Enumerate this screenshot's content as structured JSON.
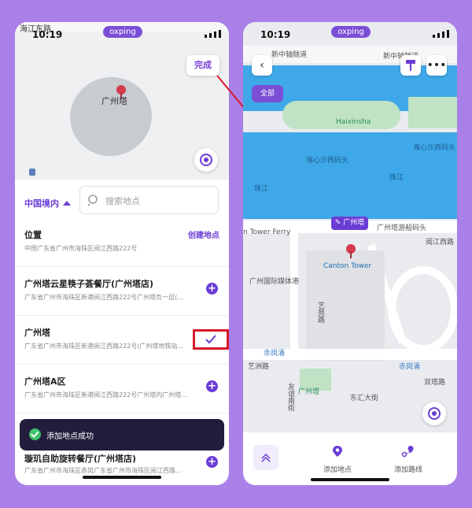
{
  "colors": {
    "accent": "#6b3cd5",
    "water": "#3ea8e8",
    "park": "#bfe3c4",
    "highlight": "#d61a2a"
  },
  "status_bar": {
    "time": "10:19",
    "pill": "oxping"
  },
  "left_phone": {
    "map": {
      "tower_label": "广州塔",
      "top_road": "海江东路",
      "done_label": "完成"
    },
    "sheet": {
      "region": "中国境内",
      "search_placeholder": "搜索地点",
      "location_title": "位置",
      "location_addr": "中国广东省广州市海珠区阅江西路222号",
      "create_label": "创建地点",
      "results": [
        {
          "title": "广州塔云星筷子荟餐厅(广州塔店)",
          "addr": "广东省广州市海珠区新港阅江西路222号广州塔负一层(...",
          "action": "add"
        },
        {
          "title": "广州塔",
          "addr": "广东省广州市海珠区新港阅江西路222号(广州塔地铁站...",
          "action": "added"
        },
        {
          "title": "广州塔A区",
          "addr": "广东省广州市海珠区新港阅江西路222号广州塔内广州塔...",
          "action": "add"
        },
        {
          "title": "璇玑自助旋转餐厅(广州塔店)",
          "addr": "广东省广州市海珠区赤岗广东省广州市海珠区阅江西路...",
          "action": "add"
        }
      ],
      "toast": "添加地点成功"
    }
  },
  "right_phone": {
    "top_labels": [
      "新中轴隧道",
      "新中轴隧道"
    ],
    "all_label": "全部",
    "tag_label": "广州塔",
    "map_labels": {
      "haixinsha": "Haixinsha",
      "pier": "海心沙西码头",
      "pier2": "海心沙西码头",
      "river_west": "珠江",
      "river_east": "珠江",
      "ferry": "n Tower Ferry",
      "pier_tower": "广州塔游船码头",
      "road_yuejiang": "阅江西路",
      "tower_en": "Canton Tower",
      "tower_cn": "广州塔",
      "media_port": "广州国际媒体港",
      "yiyuan": "艺苑路",
      "chigang": "赤岗涌",
      "yizhou": "艺洲路",
      "shuangta": "双塔路",
      "youyi": "友谊南街",
      "east_street": "东汇大街",
      "chigangyong": "赤岗涌"
    },
    "bottom_bar": {
      "add_place": "添加地点",
      "add_route": "添加路线"
    }
  }
}
